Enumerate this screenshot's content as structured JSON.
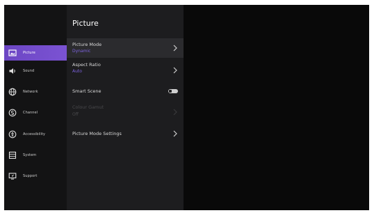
{
  "sidebar": {
    "items": [
      {
        "label": "Picture",
        "icon": "picture-icon"
      },
      {
        "label": "Sound",
        "icon": "speaker-icon"
      },
      {
        "label": "Network",
        "icon": "globe-icon"
      },
      {
        "label": "Channel",
        "icon": "channel-icon"
      },
      {
        "label": "Accessibility",
        "icon": "accessibility-icon"
      },
      {
        "label": "System",
        "icon": "system-icon"
      },
      {
        "label": "Support",
        "icon": "support-icon"
      }
    ]
  },
  "panel": {
    "title": "Picture",
    "picture_mode": {
      "label": "Picture Mode",
      "value": "Dynamic"
    },
    "aspect_ratio": {
      "label": "Aspect Ratio",
      "value": "Auto"
    },
    "smart_scene": {
      "label": "Smart Scene",
      "state": "on"
    },
    "disabled_item": {
      "label": "Colour Gamut",
      "value": "Off"
    },
    "picture_mode_settings": {
      "label": "Picture Mode Settings"
    }
  },
  "colors": {
    "accent": "#7b53d3",
    "value_text": "#7d63e0",
    "sidebar_bg": "#131314",
    "panel_bg": "#1d1d1f",
    "background": "#090909"
  }
}
